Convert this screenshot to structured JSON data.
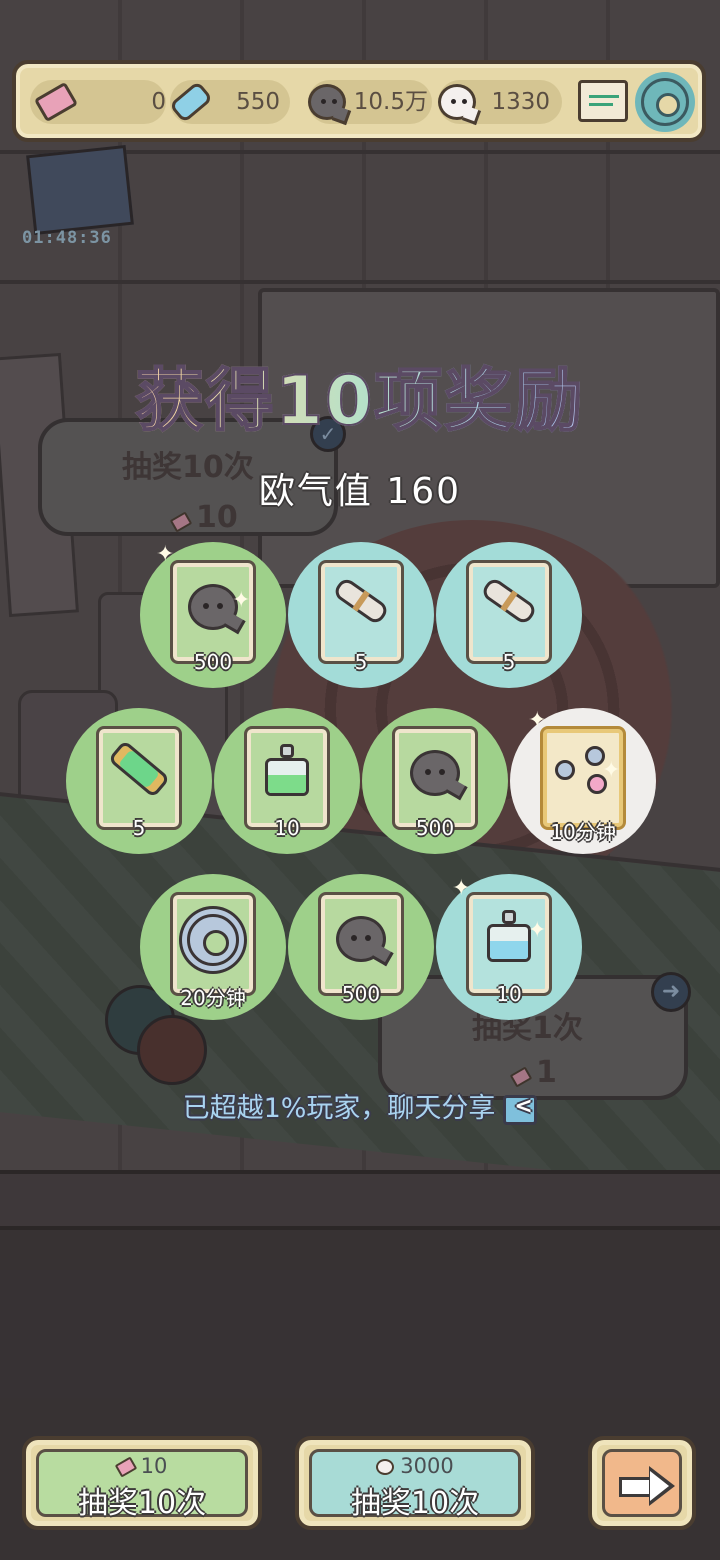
{
  "topbar": {
    "tickets": "0",
    "candy": "550",
    "dark_bubbles": "10.5万",
    "light_bubbles": "1330"
  },
  "event_timer": "01:48:36",
  "background": {
    "draw10_label": "抽奖10次",
    "draw10_cost": "10",
    "draw1_label": "抽奖1次",
    "draw1_cost": "1"
  },
  "result": {
    "title": "获得10项奖励",
    "luck_label": "欧气值 160",
    "share_text": "已超越1%玩家，聊天分享"
  },
  "rewards": [
    {
      "item": "bubble-currency",
      "qty": "500",
      "bg": "green"
    },
    {
      "item": "scroll",
      "qty": "5",
      "bg": "blue"
    },
    {
      "item": "scroll",
      "qty": "5",
      "bg": "blue"
    },
    {
      "item": "green-tube",
      "qty": "5",
      "bg": "green"
    },
    {
      "item": "green-potion",
      "qty": "10",
      "bg": "green"
    },
    {
      "item": "bubble-currency",
      "qty": "500",
      "bg": "green"
    },
    {
      "item": "molecule-boost",
      "qty": "10分钟",
      "bg": "white"
    },
    {
      "item": "gear-boost",
      "qty": "20分钟",
      "bg": "green"
    },
    {
      "item": "bubble-currency",
      "qty": "500",
      "bg": "green"
    },
    {
      "item": "blue-potion",
      "qty": "10",
      "bg": "blue"
    }
  ],
  "buttons": {
    "ticket_draw": {
      "cost": "10",
      "label": "抽奖10次"
    },
    "bubble_draw": {
      "cost": "3000",
      "label": "抽奖10次"
    }
  },
  "icons": [
    "ticket-icon",
    "candy-icon",
    "dark-bubble-icon",
    "light-bubble-icon",
    "mail-icon",
    "gear-icon",
    "share-icon",
    "next-arrow-icon"
  ],
  "colors": {
    "panel": "#e6d8a8",
    "green_item": "#9ed08a",
    "blue_item": "#a3dcd8",
    "rare_item": "#f0eeec",
    "share_text": "#a9d3ef"
  }
}
